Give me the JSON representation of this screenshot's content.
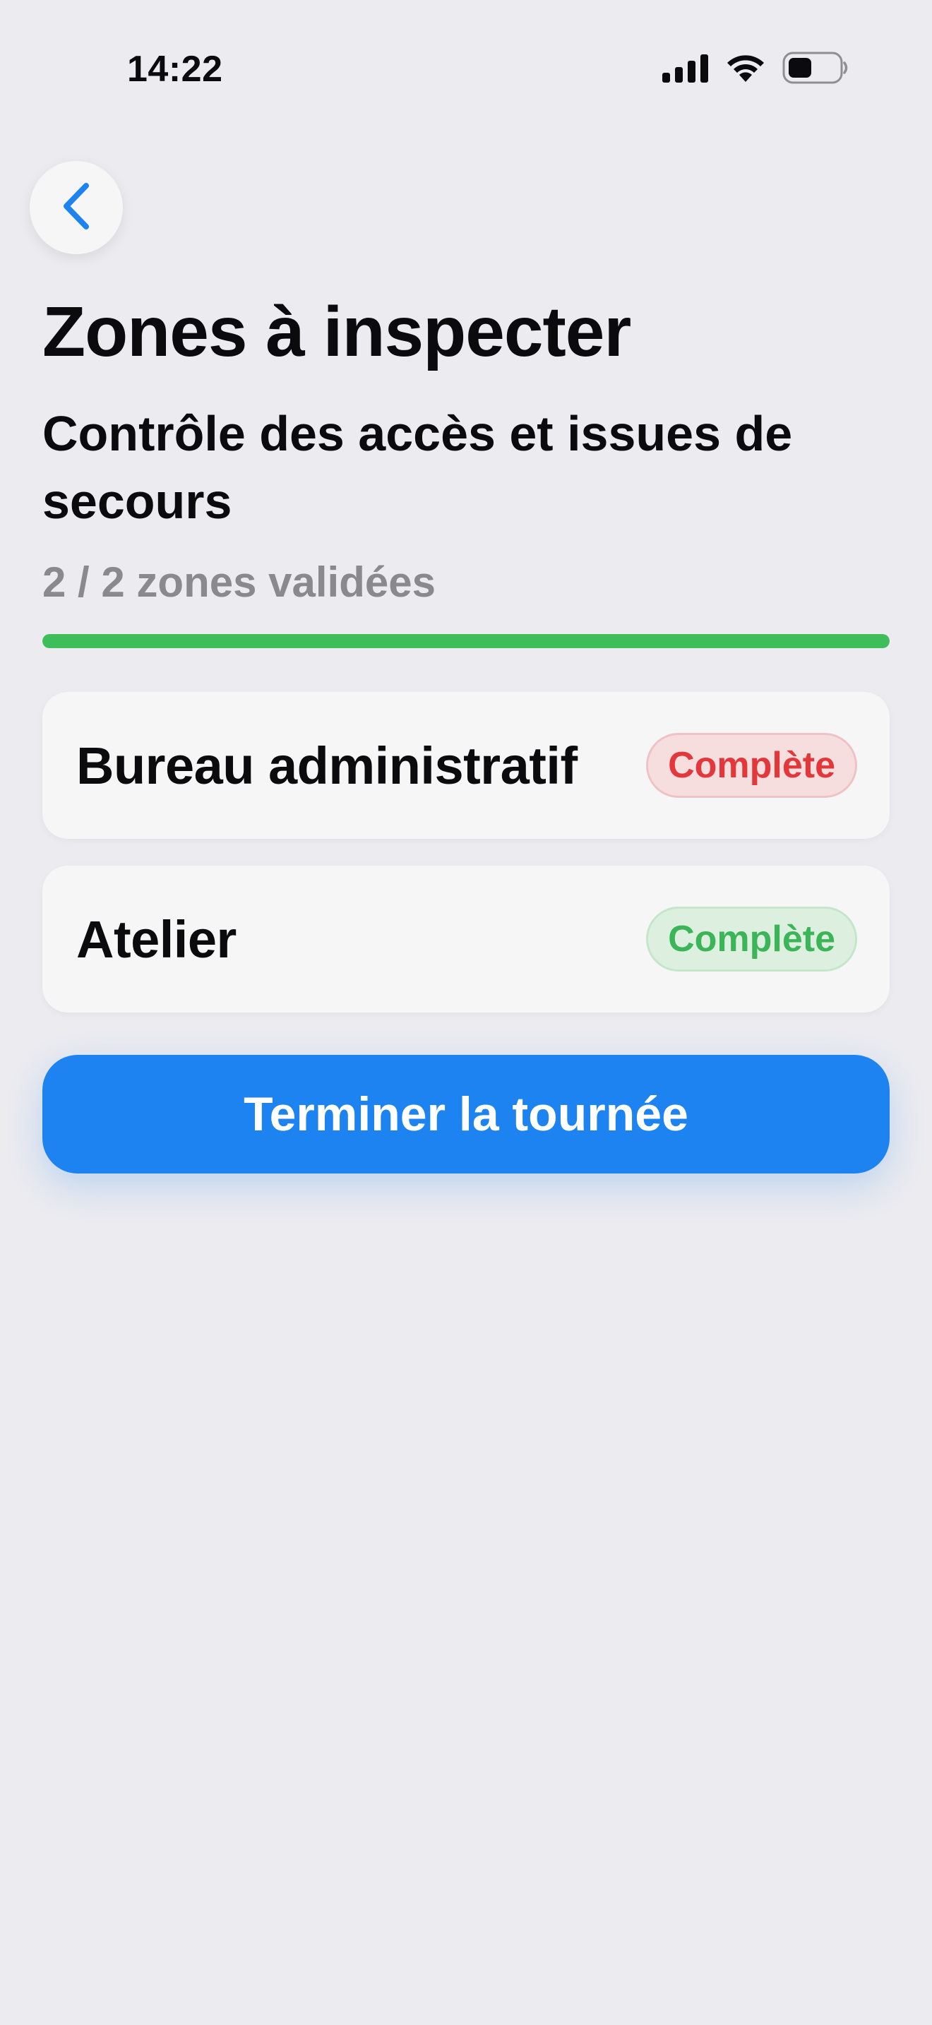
{
  "status_bar": {
    "time": "14:22",
    "icons": [
      "cellular-signal-icon",
      "wifi-icon",
      "battery-icon"
    ]
  },
  "nav": {
    "back_icon": "chevron-left-icon"
  },
  "header": {
    "title": "Zones à inspecter",
    "subtitle": "Contrôle des accès et issues de secours",
    "progress_text": "2 / 2 zones validées",
    "progress_fraction": 1.0
  },
  "zones": [
    {
      "name": "Bureau administratif",
      "status": "Complète",
      "status_color": "#E2383B"
    },
    {
      "name": "Atelier",
      "status": "Complète",
      "status_color": "#3CB458"
    }
  ],
  "actions": {
    "finish_label": "Terminer la tournée"
  },
  "colors": {
    "accent": "#1C83F0",
    "progress": "#3DBE5A",
    "background": "#EBEBF0"
  }
}
